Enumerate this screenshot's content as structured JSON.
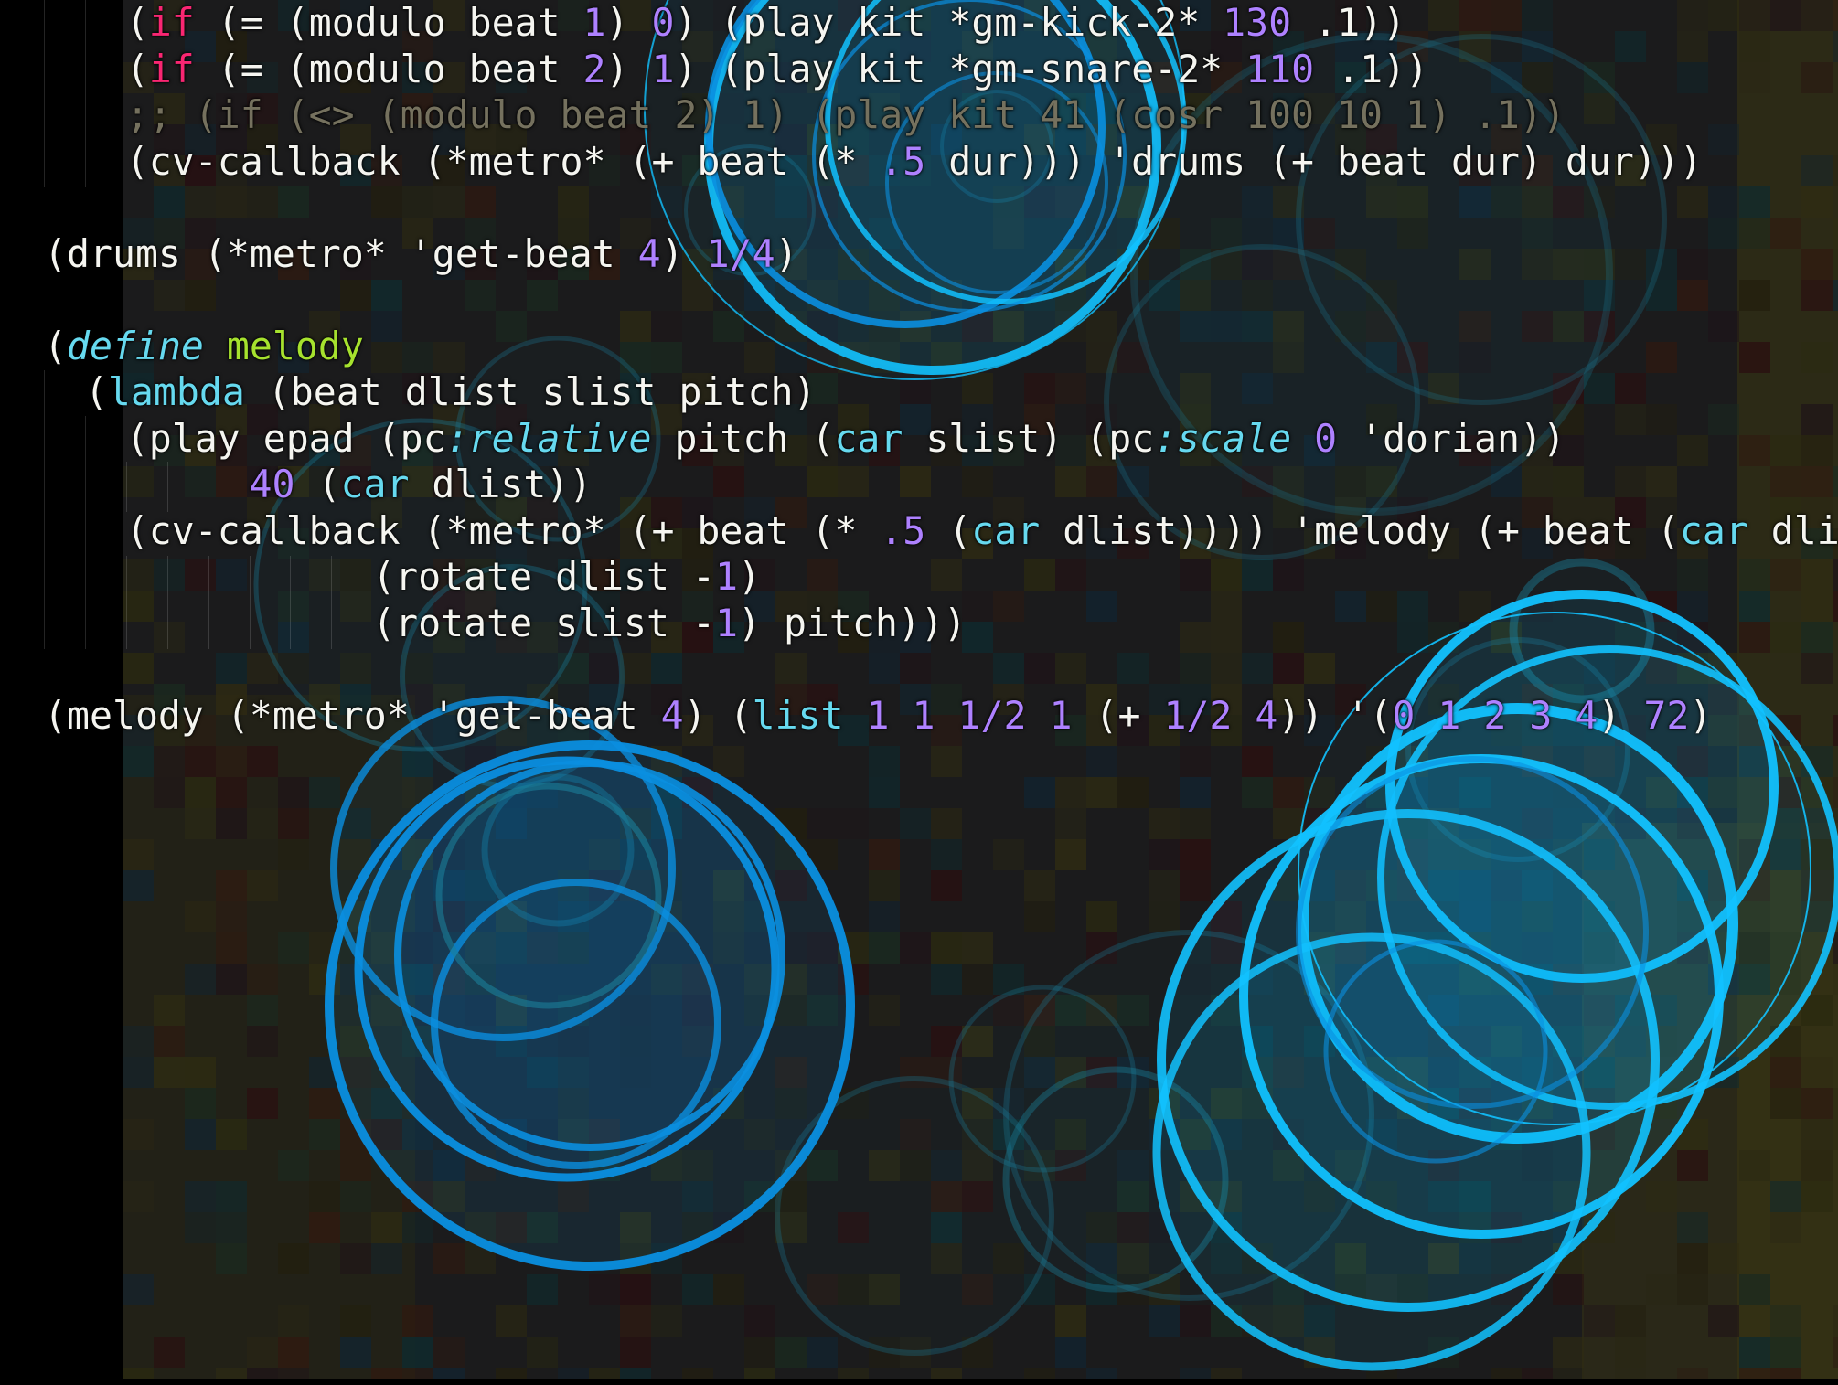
{
  "editor": {
    "lines": [
      {
        "indent": 2,
        "tokens": [
          {
            "t": "(",
            "c": "default"
          },
          {
            "t": "if",
            "c": "kw"
          },
          {
            "t": " (= (modulo beat ",
            "c": "default"
          },
          {
            "t": "1",
            "c": "num"
          },
          {
            "t": ") ",
            "c": "default"
          },
          {
            "t": "0",
            "c": "num"
          },
          {
            "t": ") (play kit *gm-kick-2* ",
            "c": "default"
          },
          {
            "t": "130",
            "c": "num"
          },
          {
            "t": " .1))",
            "c": "default"
          }
        ]
      },
      {
        "indent": 2,
        "tokens": [
          {
            "t": "(",
            "c": "default"
          },
          {
            "t": "if",
            "c": "kw"
          },
          {
            "t": " (= (modulo beat ",
            "c": "default"
          },
          {
            "t": "2",
            "c": "num"
          },
          {
            "t": ") ",
            "c": "default"
          },
          {
            "t": "1",
            "c": "num"
          },
          {
            "t": ") (play kit *gm-snare-2* ",
            "c": "default"
          },
          {
            "t": "110",
            "c": "num"
          },
          {
            "t": " .1))",
            "c": "default"
          }
        ]
      },
      {
        "indent": 2,
        "tokens": [
          {
            "t": ";; (if (<> (modulo beat 2) 1) (play kit 41 (cosr 100 10 1) .1))",
            "c": "comment"
          }
        ]
      },
      {
        "indent": 2,
        "tokens": [
          {
            "t": "(cv-callback (*metro* (+ beat (* ",
            "c": "default"
          },
          {
            "t": ".5",
            "c": "num"
          },
          {
            "t": " dur))) 'drums (+ beat dur) dur)))",
            "c": "default"
          }
        ]
      },
      {
        "indent": 0,
        "tokens": []
      },
      {
        "indent": 0,
        "tokens": [
          {
            "t": "(drums (*metro* 'get-beat ",
            "c": "default"
          },
          {
            "t": "4",
            "c": "num"
          },
          {
            "t": ") ",
            "c": "default"
          },
          {
            "t": "1/4",
            "c": "num"
          },
          {
            "t": ")",
            "c": "default"
          }
        ]
      },
      {
        "indent": 0,
        "tokens": []
      },
      {
        "indent": 0,
        "tokens": [
          {
            "t": "(",
            "c": "default"
          },
          {
            "t": "define",
            "c": "def"
          },
          {
            "t": " ",
            "c": "default"
          },
          {
            "t": "melody",
            "c": "name"
          }
        ]
      },
      {
        "indent": 1,
        "tokens": [
          {
            "t": "(",
            "c": "default"
          },
          {
            "t": "lambda",
            "c": "call"
          },
          {
            "t": " (beat dlist slist pitch)",
            "c": "default"
          }
        ]
      },
      {
        "indent": 2,
        "tokens": [
          {
            "t": "(play epad (pc",
            "c": "default"
          },
          {
            "t": ":relative",
            "c": "def"
          },
          {
            "t": " pitch (",
            "c": "default"
          },
          {
            "t": "car",
            "c": "call"
          },
          {
            "t": " slist) (pc",
            "c": "default"
          },
          {
            "t": ":scale",
            "c": "def"
          },
          {
            "t": " ",
            "c": "default"
          },
          {
            "t": "0",
            "c": "num"
          },
          {
            "t": " 'dorian))",
            "c": "default"
          }
        ]
      },
      {
        "indent": 5,
        "tokens": [
          {
            "t": "40",
            "c": "num"
          },
          {
            "t": " (",
            "c": "default"
          },
          {
            "t": "car",
            "c": "call"
          },
          {
            "t": " dlist))",
            "c": "default"
          }
        ]
      },
      {
        "indent": 2,
        "tokens": [
          {
            "t": "(cv-callback (*metro* (+ beat (* ",
            "c": "default"
          },
          {
            "t": ".5",
            "c": "num"
          },
          {
            "t": " (",
            "c": "default"
          },
          {
            "t": "car",
            "c": "call"
          },
          {
            "t": " dlist)))) 'melody (+ beat (",
            "c": "default"
          },
          {
            "t": "car",
            "c": "call"
          },
          {
            "t": " dlist))",
            "c": "default"
          }
        ]
      },
      {
        "indent": 8,
        "tokens": [
          {
            "t": "(rotate dlist -",
            "c": "default"
          },
          {
            "t": "1",
            "c": "num"
          },
          {
            "t": ")",
            "c": "default"
          }
        ]
      },
      {
        "indent": 8,
        "tokens": [
          {
            "t": "(rotate slist -",
            "c": "default"
          },
          {
            "t": "1",
            "c": "num"
          },
          {
            "t": ") pitch)))",
            "c": "default"
          }
        ]
      },
      {
        "indent": 0,
        "tokens": []
      },
      {
        "indent": 0,
        "tokens": [
          {
            "t": "(melody (*metro* 'get-beat ",
            "c": "default"
          },
          {
            "t": "4",
            "c": "num"
          },
          {
            "t": ") (",
            "c": "default"
          },
          {
            "t": "list",
            "c": "call"
          },
          {
            "t": " ",
            "c": "default"
          },
          {
            "t": "1",
            "c": "num"
          },
          {
            "t": " ",
            "c": "default"
          },
          {
            "t": "1",
            "c": "num"
          },
          {
            "t": " ",
            "c": "default"
          },
          {
            "t": "1/2",
            "c": "num"
          },
          {
            "t": " ",
            "c": "default"
          },
          {
            "t": "1",
            "c": "num"
          },
          {
            "t": " (+ ",
            "c": "default"
          },
          {
            "t": "1/2",
            "c": "num"
          },
          {
            "t": " ",
            "c": "default"
          },
          {
            "t": "4",
            "c": "num"
          },
          {
            "t": ")) '(",
            "c": "default"
          },
          {
            "t": "0",
            "c": "num"
          },
          {
            "t": " ",
            "c": "default"
          },
          {
            "t": "1",
            "c": "num"
          },
          {
            "t": " ",
            "c": "default"
          },
          {
            "t": "2",
            "c": "num"
          },
          {
            "t": " ",
            "c": "default"
          },
          {
            "t": "3",
            "c": "num"
          },
          {
            "t": " ",
            "c": "default"
          },
          {
            "t": "4",
            "c": "num"
          },
          {
            "t": ") ",
            "c": "default"
          },
          {
            "t": "72",
            "c": "num"
          },
          {
            "t": ")",
            "c": "default"
          }
        ]
      }
    ]
  },
  "colors": {
    "background": "#1b1b1c",
    "default_text": "#f5f5f0",
    "keyword": "#f92672",
    "number": "#ae81ff",
    "builtin": "#66d9ef",
    "definition_name": "#a6e22e",
    "comment": "#75715e",
    "ring_bright": "#12c2ff",
    "ring_mid": "#0a8fe0",
    "ring_dim": "#1a7f9a",
    "mosaic_olive": "#2a2a12",
    "mosaic_red": "#2a0e0e"
  }
}
